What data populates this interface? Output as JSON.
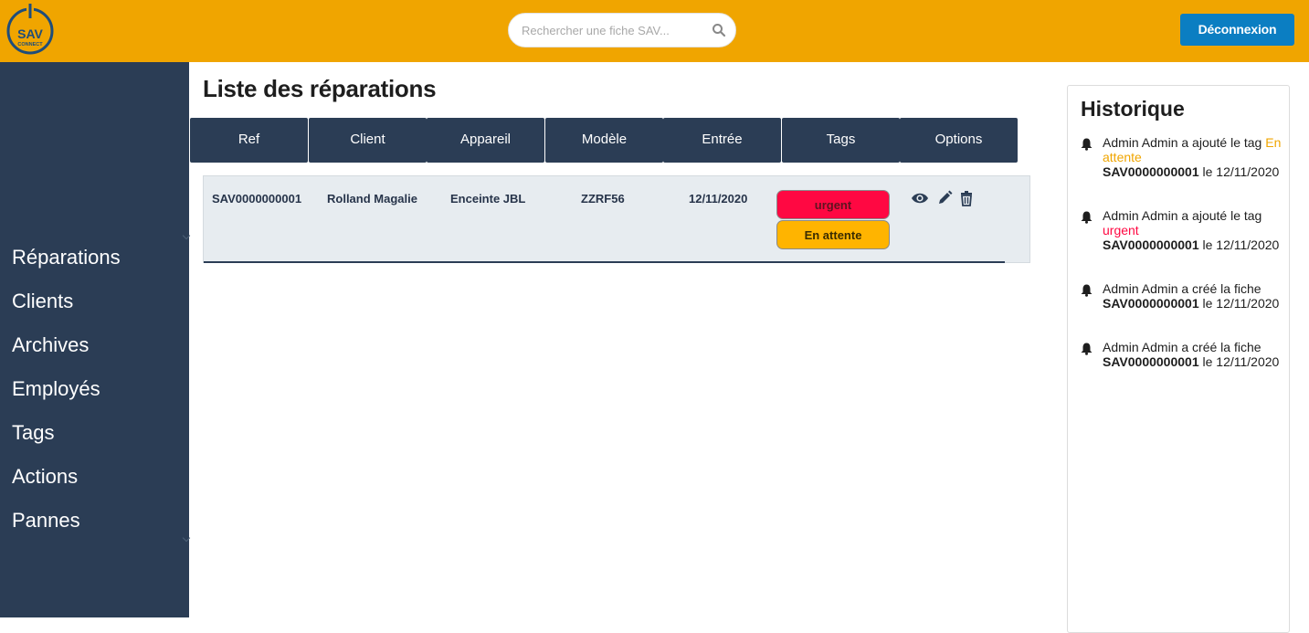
{
  "header": {
    "logo": {
      "top_text": "SAV",
      "bottom_text": "CONNECT"
    },
    "search": {
      "placeholder": "Rechercher une fiche SAV..."
    },
    "logout_label": "Déconnexion",
    "colors": {
      "bar": "#f0a500",
      "logout": "#0b7ec2"
    }
  },
  "sidebar": {
    "color": "#2b3d55",
    "items": [
      {
        "label": "Réparations"
      },
      {
        "label": "Clients"
      },
      {
        "label": "Archives"
      },
      {
        "label": "Employés"
      },
      {
        "label": "Tags"
      },
      {
        "label": "Actions"
      },
      {
        "label": "Pannes"
      }
    ]
  },
  "main": {
    "title": "Liste des réparations",
    "columns": [
      "Ref",
      "Client",
      "Appareil",
      "Modèle",
      "Entrée",
      "Tags",
      "Options"
    ],
    "rows": [
      {
        "ref": "SAV0000000001",
        "client": "Rolland Magalie",
        "device": "Enceinte JBL",
        "model": "ZZRF56",
        "entry": "12/11/2020",
        "tags": [
          {
            "label": "urgent",
            "color": "#ff0842"
          },
          {
            "label": "En attente",
            "color": "#ffb400"
          }
        ],
        "actions": [
          "eye-icon",
          "pencil-icon",
          "trash-icon"
        ]
      }
    ]
  },
  "history": {
    "title": "Historique",
    "entries": [
      {
        "p1": "Admin Admin a ajouté le tag ",
        "tag": "En attente",
        "ref": "SAV0000000001",
        "p2": " le 12/11/2020"
      },
      {
        "p1": "Admin Admin a ajouté le tag ",
        "tag": "urgent",
        "ref": "SAV0000000001",
        "p2": " le 12/11/2020"
      },
      {
        "p1": "Admin Admin a créé la fiche ",
        "ref": "SAV0000000001",
        "p2": " le 12/11/2020"
      },
      {
        "p1": "Admin Admin a créé la fiche ",
        "ref": "SAV0000000001",
        "p2": " le 12/11/2020"
      }
    ]
  }
}
